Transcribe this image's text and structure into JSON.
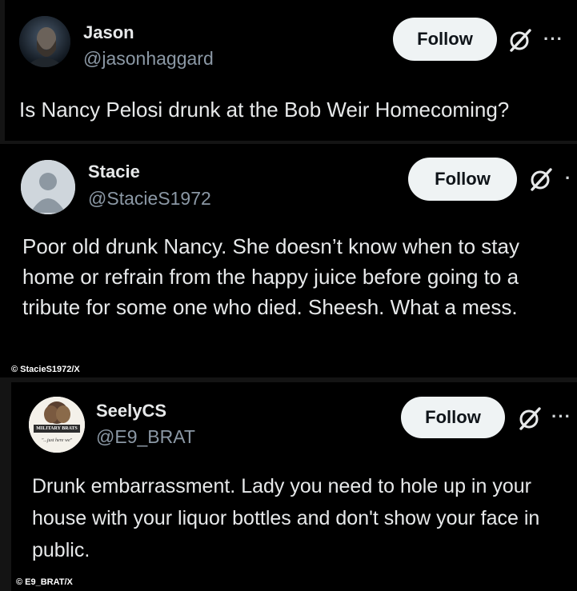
{
  "posts": [
    {
      "author": "Jason",
      "handle": "@jasonhaggard",
      "follow_label": "Follow",
      "more_label": "···",
      "text": "Is Nancy Pelosi drunk at the Bob Weir Homecoming?",
      "avatar_icon": "profile-photo-icon",
      "action_icon": "grok-icon"
    },
    {
      "author": "Stacie",
      "handle": "@StacieS1972",
      "follow_label": "Follow",
      "more_label": "·",
      "text": "Poor old drunk Nancy. She doesn’t know when to stay home or refrain from the happy juice before going to a tribute for some one who died. Sheesh. What a mess.",
      "credit": "© StacieS1972/X",
      "avatar_icon": "default-avatar-icon",
      "action_icon": "grok-icon"
    },
    {
      "author": "SeelyCS",
      "handle": "@E9_BRAT",
      "follow_label": "Follow",
      "more_label": "···",
      "text": "Drunk embarrassment.  Lady you need to hole up in your house with your liquor bottles and don't show your face in public.",
      "credit": "© E9_BRAT/X",
      "avatar_text_top": "MILITARY BRATS",
      "avatar_text_bottom": "\"...just here we\"",
      "avatar_icon": "military-brats-logo-icon",
      "action_icon": "grok-icon"
    }
  ],
  "colors": {
    "background": "#000000",
    "text": "#e7e9ea",
    "handle": "#8b98a5",
    "follow_bg": "#eff3f4",
    "follow_text": "#0f1419"
  }
}
